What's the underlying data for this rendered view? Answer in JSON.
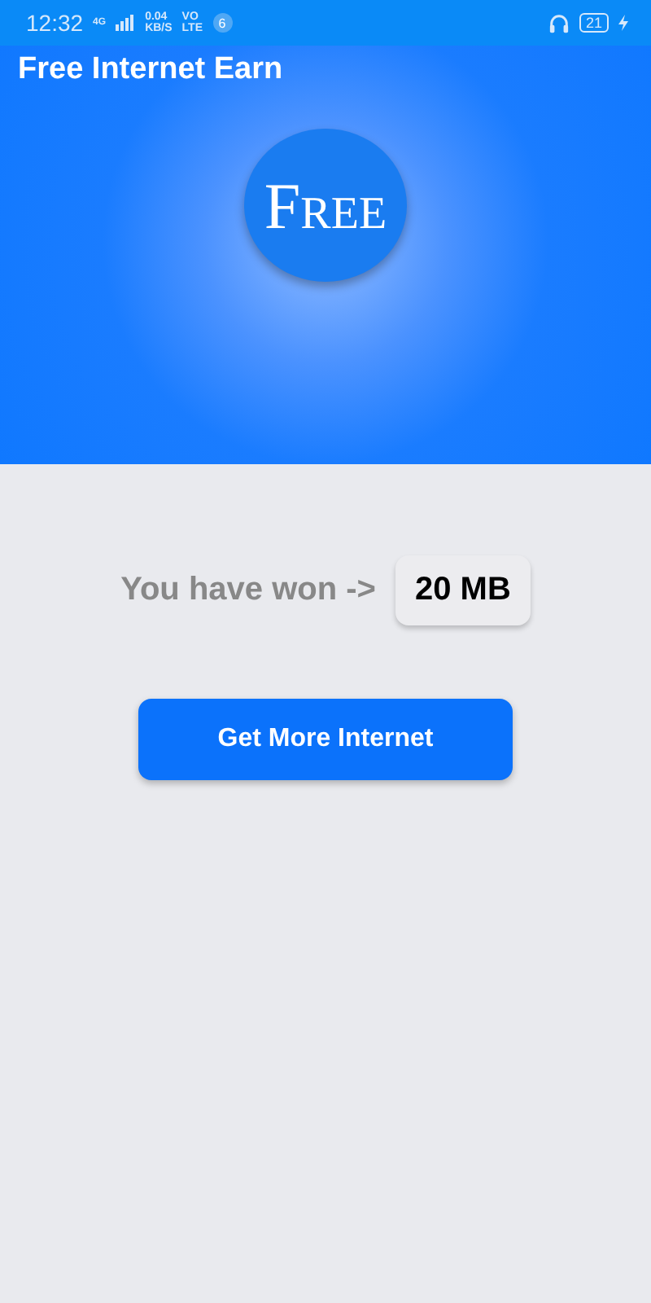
{
  "status_bar": {
    "time": "12:32",
    "network": "4G",
    "speed_value": "0.04",
    "speed_unit": "KB/S",
    "volte_top": "VO",
    "volte_bottom": "LTE",
    "notification_count": "6",
    "battery": "21"
  },
  "app_bar": {
    "title": "Free Internet Earn"
  },
  "logo": {
    "text": "Free"
  },
  "reward": {
    "label": "You have won ->",
    "amount": "20 MB"
  },
  "buttons": [
    "Get More Internet"
  ]
}
